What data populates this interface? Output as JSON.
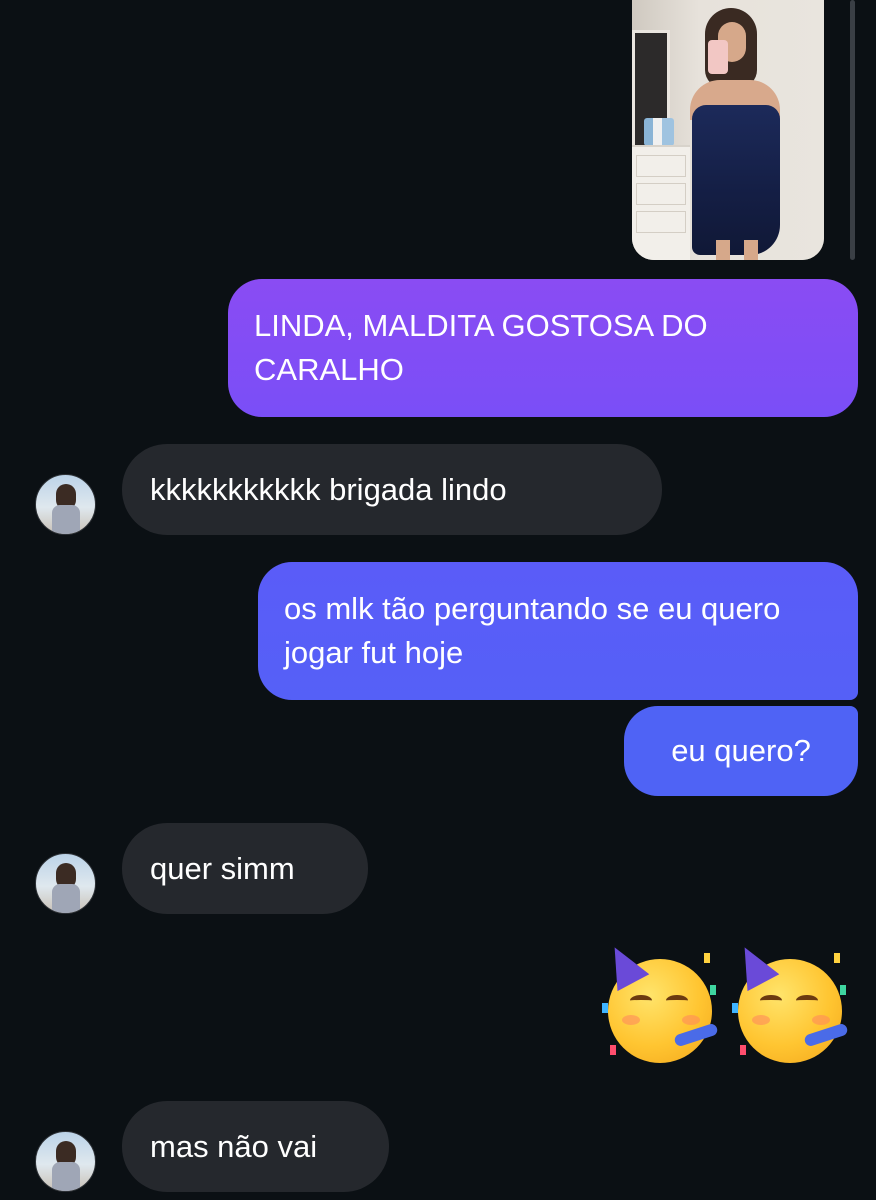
{
  "conversation": {
    "shared_photo": {
      "alt": "mirror selfie in navy dress"
    },
    "messages": [
      {
        "id": "m1",
        "direction": "outgoing",
        "text": "LINDA, MALDITA GOSTOSA DO CARALHO"
      },
      {
        "id": "m2",
        "direction": "incoming",
        "text": "kkkkkkkkkkk brigada lindo"
      },
      {
        "id": "m3",
        "direction": "outgoing",
        "text": "os mlk tão perguntando se eu quero jogar fut hoje"
      },
      {
        "id": "m4",
        "direction": "outgoing",
        "text": "eu quero?"
      },
      {
        "id": "m5",
        "direction": "incoming",
        "text": "quer simm"
      },
      {
        "id": "m6",
        "direction": "outgoing",
        "text": "🥳🥳"
      },
      {
        "id": "m7",
        "direction": "incoming",
        "text": "mas não vai"
      }
    ]
  },
  "colors": {
    "background": "#0b1014",
    "incoming_bubble": "#25282d",
    "outgoing_gradient_top": "#8a4cf3",
    "outgoing_gradient_bottom": "#4f63f5",
    "text": "#ffffff"
  },
  "icons": {
    "emoji": "partying-face-emoji",
    "avatar": "contact-avatar"
  }
}
